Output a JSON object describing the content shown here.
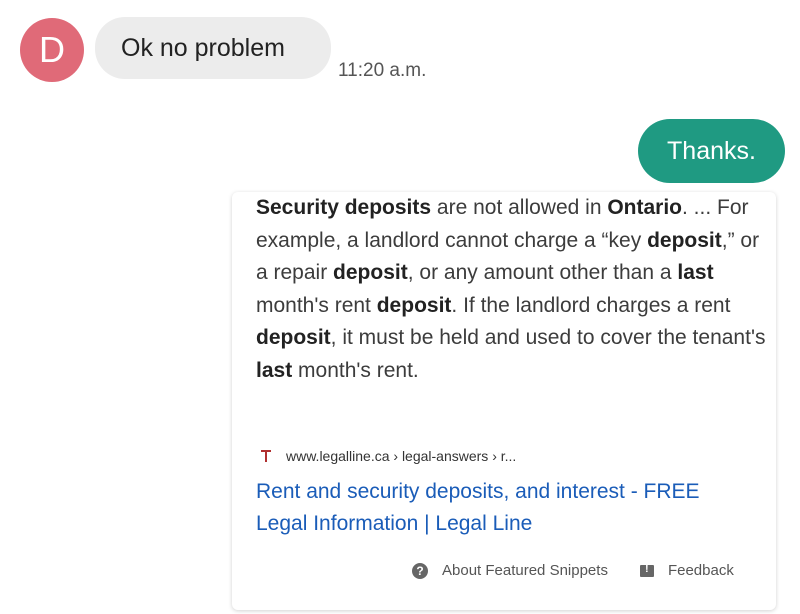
{
  "contact": {
    "avatar_letter": "D"
  },
  "messages": {
    "incoming": {
      "text": "Ok no problem",
      "time": "11:20 a.m."
    },
    "outgoing": {
      "text": "Thanks."
    }
  },
  "snippet": {
    "segments": [
      {
        "t": "Security deposits",
        "b": true
      },
      {
        "t": " are not allowed in ",
        "b": false
      },
      {
        "t": "Ontario",
        "b": true
      },
      {
        "t": ". ... For example, a landlord cannot charge a “key ",
        "b": false
      },
      {
        "t": "deposit",
        "b": true
      },
      {
        "t": ",” or a repair ",
        "b": false
      },
      {
        "t": "deposit",
        "b": true
      },
      {
        "t": ", or any amount other than a ",
        "b": false
      },
      {
        "t": "last",
        "b": true
      },
      {
        "t": " month's rent ",
        "b": false
      },
      {
        "t": "deposit",
        "b": true
      },
      {
        "t": ". If the landlord charges a rent ",
        "b": false
      },
      {
        "t": "deposit",
        "b": true
      },
      {
        "t": ", it must be held and used to cover the tenant's ",
        "b": false
      },
      {
        "t": "last",
        "b": true
      },
      {
        "t": " month's rent.",
        "b": false
      }
    ],
    "source_url": "www.legalline.ca › legal-answers › r...",
    "link_title": "Rent and security deposits, and interest - FREE Legal Information | Legal Line",
    "about_label": "About Featured Snippets",
    "feedback_label": "Feedback"
  },
  "colors": {
    "avatar": "#e06a78",
    "outgoing_bubble": "#1f9a82",
    "incoming_bubble": "#ececec",
    "link": "#1a5cb8"
  },
  "icons": {
    "favicon": "legalline-favicon-icon",
    "help": "help-circle-icon",
    "feedback": "feedback-icon"
  }
}
